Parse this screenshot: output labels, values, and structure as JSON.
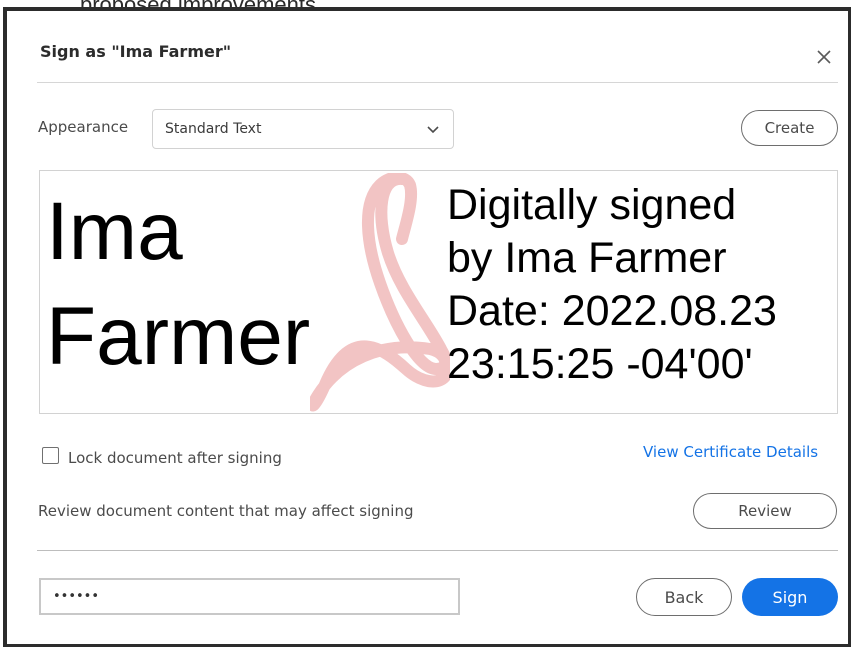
{
  "background": {
    "visible_text": "proposed improvements."
  },
  "dialog": {
    "title": "Sign as \"Ima Farmer\"",
    "close_icon": "close-icon",
    "appearance_label": "Appearance",
    "appearance_selected": "Standard Text",
    "create_label": "Create",
    "preview": {
      "name_line1": "Ima",
      "name_line2": "Farmer",
      "details_line1": "Digitally signed",
      "details_line2": "by Ima Farmer",
      "details_line3": "Date: 2022.08.23",
      "details_line4": "23:15:25 -04'00'",
      "watermark_icon": "acrobat-logo-watermark"
    },
    "lock_label": "Lock document after signing",
    "lock_checked": false,
    "view_certificate_label": "View Certificate Details",
    "review_text": "Review document content that may affect signing",
    "review_label": "Review",
    "password_value": "••••••",
    "back_label": "Back",
    "sign_label": "Sign"
  },
  "colors": {
    "accent": "#1473e6",
    "watermark": "#f2c4c4",
    "frame": "#2c2c2c"
  }
}
